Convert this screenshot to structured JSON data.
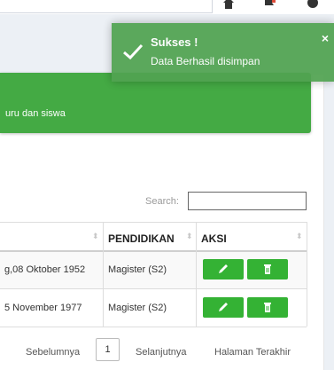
{
  "toast": {
    "title": "Sukses !",
    "message": "Data Berhasil disimpan",
    "close": "×"
  },
  "banner": {
    "text": "uru dan siswa"
  },
  "search": {
    "label": "Search:",
    "value": ""
  },
  "table": {
    "headers": [
      "PENDIDIKAN",
      "AKSI"
    ],
    "rows": [
      {
        "tanggal": "g,08 Oktober 1952",
        "pendidikan": "Magister (S2)"
      },
      {
        "tanggal": "5 November 1977",
        "pendidikan": "Magister (S2)"
      }
    ]
  },
  "pagination": {
    "previous": "Sebelumnya",
    "current": "1",
    "next": "Selanjutnya",
    "last": "Halaman Terakhir"
  },
  "colors": {
    "toast": "#51a351",
    "banner": "#44aa44",
    "button": "#34b234"
  },
  "icons": [
    "home-icon",
    "flag-icon",
    "user-icon",
    "check-icon",
    "close-icon",
    "sort-icon",
    "pencil-icon",
    "trash-icon"
  ]
}
